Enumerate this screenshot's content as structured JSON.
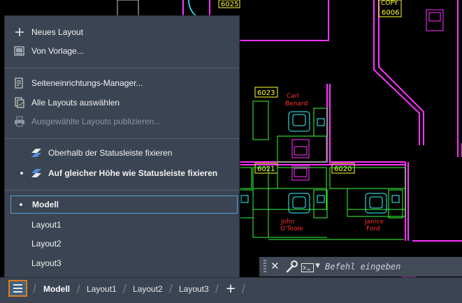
{
  "drawing": {
    "rooms": [
      {
        "number": "6025"
      },
      {
        "number": "6006",
        "label": "COPY"
      },
      {
        "number": "6023",
        "occupant": [
          "Carl",
          "Benard"
        ]
      },
      {
        "number": "6021",
        "occupant": [
          "John",
          "O'Toole"
        ]
      },
      {
        "number": "6020",
        "occupant": [
          "Janice",
          "Ford"
        ]
      }
    ],
    "colors": {
      "walls": "#ff33ff",
      "furniture": "#33ff33",
      "tags": "#ffff33",
      "names": "#ff3333",
      "chairs": "#33ffff"
    }
  },
  "menu": {
    "new_layout": "Neues Layout",
    "from_template": "Von Vorlage...",
    "page_setup": "Seiteneinrichtungs-Manager...",
    "select_all": "Alle Layouts auswählen",
    "publish": "Ausgewählte Layouts publizieren...",
    "dock_above": "Oberhalb der Statusleiste fixieren",
    "dock_inline": "Auf gleicher Höhe wie Statusleiste fixieren",
    "model": "Modell",
    "layout1": "Layout1",
    "layout2": "Layout2",
    "layout3": "Layout3"
  },
  "tabs": {
    "model": "Modell",
    "layout1": "Layout1",
    "layout2": "Layout2",
    "layout3": "Layout3",
    "add": "+"
  },
  "command": {
    "close": "✕",
    "placeholder": "Befehl eingeben"
  }
}
